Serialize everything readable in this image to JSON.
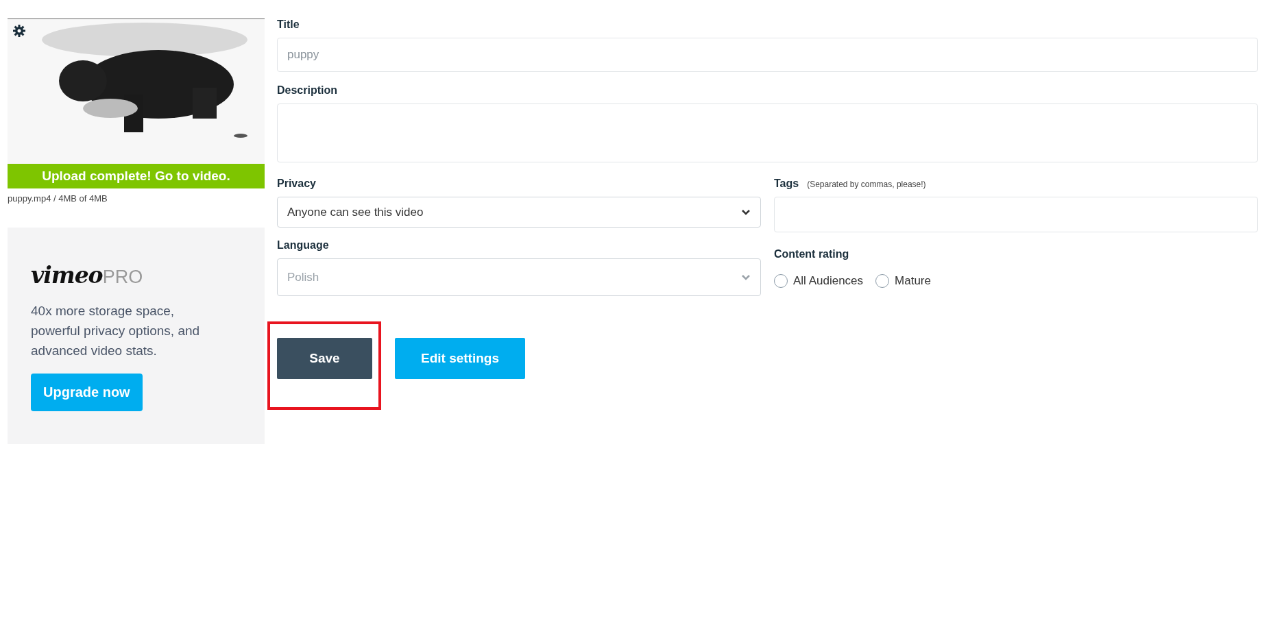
{
  "upload": {
    "status": "Upload complete! Go to video.",
    "file_info": "puppy.mp4 / 4MB of 4MB"
  },
  "promo": {
    "brand": "vimeo",
    "tier": "PRO",
    "text": "40x more storage space, powerful privacy options, and advanced video stats.",
    "button": "Upgrade now"
  },
  "form": {
    "title": {
      "label": "Title",
      "placeholder": "puppy"
    },
    "description": {
      "label": "Description"
    },
    "privacy": {
      "label": "Privacy",
      "value": "Anyone can see this video",
      "disabled": false
    },
    "language": {
      "label": "Language",
      "value": "Polish",
      "disabled": true
    },
    "tags": {
      "label": "Tags",
      "hint": "(Separated by commas, please!)"
    },
    "content_rating": {
      "label": "Content rating",
      "options": [
        {
          "label": "All Audiences",
          "selected": false
        },
        {
          "label": "Mature",
          "selected": false
        }
      ]
    }
  },
  "buttons": [
    {
      "label": "Save",
      "kind": "primary",
      "highlighted": true
    },
    {
      "label": "Edit settings",
      "kind": "secondary",
      "highlighted": false
    }
  ]
}
